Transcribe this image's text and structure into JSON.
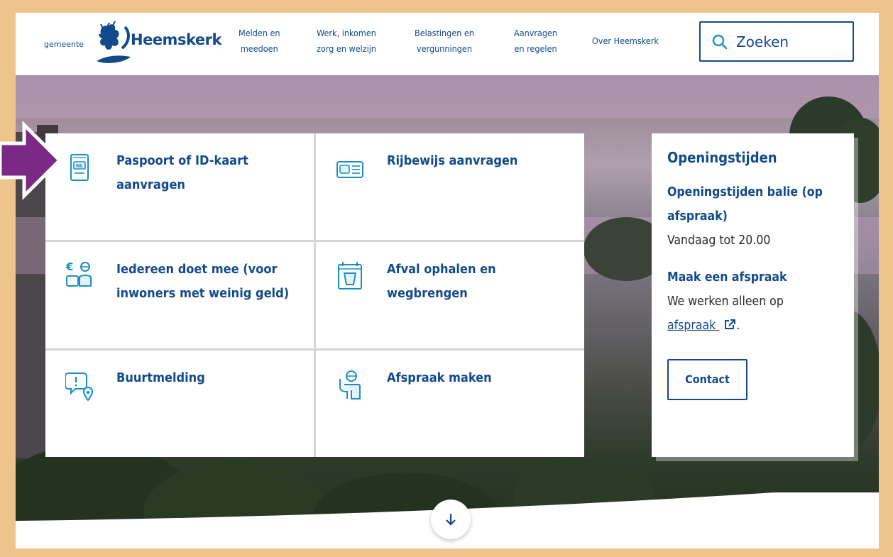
{
  "header": {
    "logo_small": "gemeente",
    "logo_big": "Heemskerk",
    "nav": [
      {
        "line1": "Melden en",
        "line2": "meedoen"
      },
      {
        "line1": "Werk, inkomen",
        "line2": "zorg en welzijn"
      },
      {
        "line1": "Belastingen en",
        "line2": "vergunningen"
      },
      {
        "line1": "Aanvragen",
        "line2": "en regelen"
      },
      {
        "line1": "Over Heemskerk",
        "line2": ""
      }
    ],
    "search_placeholder": "Zoeken"
  },
  "tiles": [
    {
      "line1": "Paspoort of ID-kaart",
      "line2": "aanvragen",
      "icon": "passport-icon"
    },
    {
      "line1": "Rijbewijs aanvragen",
      "line2": "",
      "icon": "driving-license-icon"
    },
    {
      "line1": "Iedereen doet mee (voor",
      "line2": "inwoners met weinig geld)",
      "icon": "money-people-icon"
    },
    {
      "line1": "Afval ophalen en",
      "line2": "wegbrengen",
      "icon": "waste-bin-icon"
    },
    {
      "line1": "Buurtmelding",
      "line2": "",
      "icon": "report-location-icon"
    },
    {
      "line1": "Afspraak maken",
      "line2": "",
      "icon": "appointment-person-icon"
    }
  ],
  "hours": {
    "title": "Openingstijden",
    "counter_title": "Openingstijden balie (op afspraak)",
    "counter_text": "Vandaag tot 20.00",
    "appointment_title": "Maak een afspraak",
    "appointment_text": "We werken alleen op",
    "appointment_link": "afspraak",
    "appointment_suffix": ".",
    "contact_label": "Contact"
  },
  "colors": {
    "brand": "#124a8c",
    "icon": "#1b8fc2",
    "annotation_arrow": "#7a2a84",
    "frame": "#f1c38c"
  }
}
